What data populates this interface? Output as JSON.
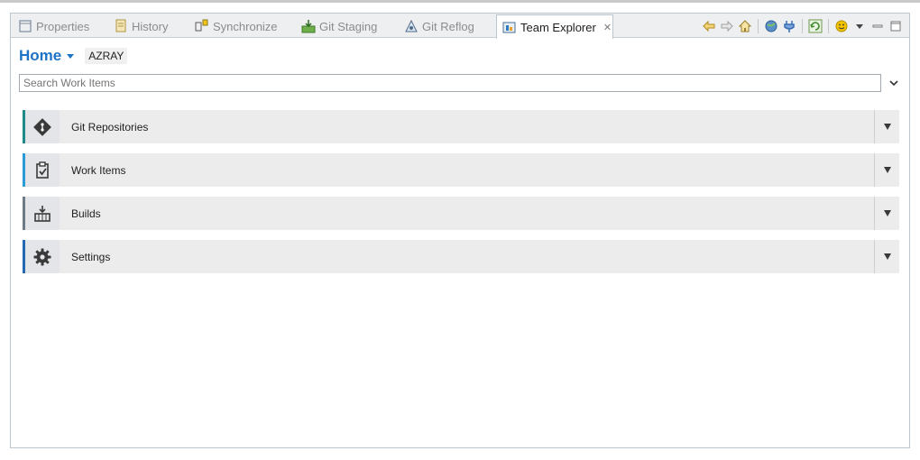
{
  "tabs": [
    {
      "label": "Properties",
      "icon": "properties-icon",
      "active": false
    },
    {
      "label": "History",
      "icon": "history-icon",
      "active": false
    },
    {
      "label": "Synchronize",
      "icon": "synchronize-icon",
      "active": false
    },
    {
      "label": "Git Staging",
      "icon": "git-staging-icon",
      "active": false
    },
    {
      "label": "Git Reflog",
      "icon": "git-reflog-icon",
      "active": false
    },
    {
      "label": "Team Explorer",
      "icon": "team-explorer-icon",
      "active": true,
      "close": "✕"
    }
  ],
  "toolbar": {
    "icons": [
      "back-icon",
      "forward-icon",
      "home-icon",
      "web-icon",
      "connect-icon",
      "refresh-icon",
      "feedback-smiley-icon",
      "view-menu-icon",
      "minimize-icon",
      "maximize-icon"
    ]
  },
  "header": {
    "home_label": "Home",
    "project": "AZRAY"
  },
  "search": {
    "placeholder": "Search Work Items"
  },
  "sections": [
    {
      "label": "Git Repositories",
      "icon": "git-icon",
      "accent": "#1f8a8a"
    },
    {
      "label": "Work Items",
      "icon": "clipboard-check-icon",
      "accent": "#2b9bd8"
    },
    {
      "label": "Builds",
      "icon": "build-icon",
      "accent": "#6e7a86"
    },
    {
      "label": "Settings",
      "icon": "gear-icon",
      "accent": "#2468b3"
    }
  ],
  "colors": {
    "accent": "#1e73c6",
    "tab_bar": "#eeeff1",
    "section_bg": "#ececec"
  }
}
